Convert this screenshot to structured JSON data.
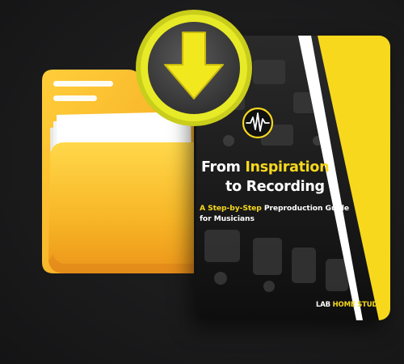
{
  "ebook": {
    "title_part1": "From ",
    "title_highlight": "Inspiration",
    "title_part2": "to Recording",
    "subtitle_highlight": "A Step-by-Step",
    "subtitle_rest": " Preproduction Guide for Musicians",
    "brand_part1": "LAB ",
    "brand_part2": "HOME STUDIO"
  },
  "icons": {
    "badge": "download-arrow-icon",
    "logo": "waveform-icon",
    "folder": "folder-icon"
  },
  "colors": {
    "accent_yellow": "#f7d81c",
    "folder_orange": "#f5a623",
    "background": "#1b1b1c"
  }
}
